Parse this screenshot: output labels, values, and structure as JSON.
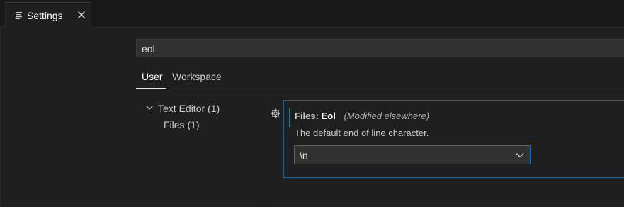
{
  "tab": {
    "label": "Settings"
  },
  "search": {
    "value": "eol"
  },
  "scopes": {
    "user": "User",
    "workspace": "Workspace"
  },
  "toc": {
    "group": "Text Editor (1)",
    "child": "Files (1)"
  },
  "setting": {
    "category": "Files:",
    "name": "Eol",
    "modified_note": "(Modified elsewhere)",
    "description": "The default end of line character.",
    "selected_value": "\\n"
  },
  "colors": {
    "accent": "#0078d4",
    "focus_border": "#0e639c"
  }
}
